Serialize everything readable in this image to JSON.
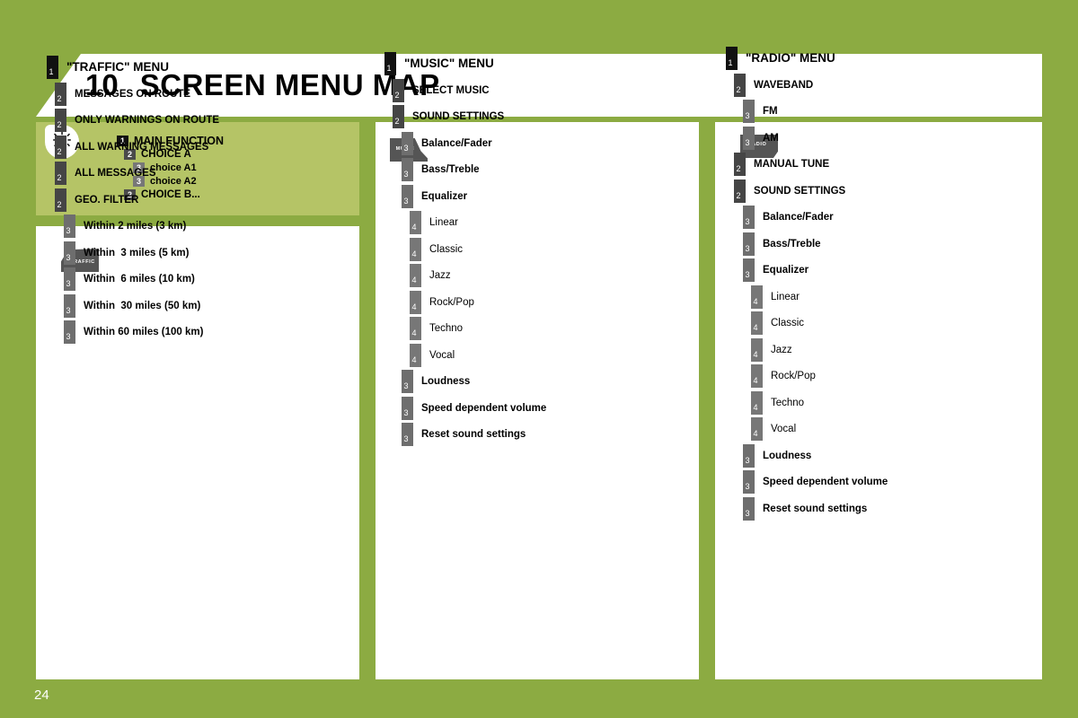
{
  "page": {
    "background_color": "#8cab42",
    "page_number": "24"
  },
  "header": {
    "chapter_number": "10",
    "title": "SCREEN MENU MAP"
  },
  "legend": {
    "icon_name": "info-bulb-icon",
    "box_color": "#b5c466",
    "items": [
      {
        "level": 1,
        "label": "MAIN FUNCTION",
        "badge": "1",
        "badge_color": "#111111"
      },
      {
        "level": 2,
        "label": "CHOICE A",
        "badge": "2",
        "badge_color": "#4a4a4a"
      },
      {
        "level": 3,
        "label": "choice A1",
        "badge": "3",
        "badge_color": "#777777"
      },
      {
        "level": 3,
        "label": "choice A2",
        "badge": "3",
        "badge_color": "#777777"
      },
      {
        "level": 2,
        "label": "CHOICE B...",
        "badge": "2",
        "badge_color": "#4a4a4a"
      }
    ]
  },
  "columns": [
    {
      "id": "traffic",
      "icon_label": "TRAFFIC",
      "icon_name": "traffic-button-icon",
      "items": [
        {
          "level": 1,
          "badge": "1",
          "label": "\"TRAFFIC\" MENU"
        },
        {
          "level": 2,
          "badge": "2",
          "label": "MESSAGES ON ROUTE"
        },
        {
          "level": 2,
          "badge": "2",
          "label": "ONLY WARNINGS ON ROUTE"
        },
        {
          "level": 2,
          "badge": "2",
          "label": "ALL WARNING MESSAGES"
        },
        {
          "level": 2,
          "badge": "2",
          "label": "ALL MESSAGES"
        },
        {
          "level": 2,
          "badge": "2",
          "label": "GEO. FILTER"
        },
        {
          "level": 3,
          "badge": "3",
          "label": "Within 2 miles (3 km)"
        },
        {
          "level": 3,
          "badge": "3",
          "label": "Within  3 miles (5 km)"
        },
        {
          "level": 3,
          "badge": "3",
          "label": "Within  6 miles (10 km)"
        },
        {
          "level": 3,
          "badge": "3",
          "label": "Within  30 miles (50 km)"
        },
        {
          "level": 3,
          "badge": "3",
          "label": "Within 60 miles (100 km)"
        }
      ]
    },
    {
      "id": "music",
      "icon_label": "MUSIC",
      "icon_name": "music-button-icon",
      "items": [
        {
          "level": 1,
          "badge": "1",
          "label": "\"MUSIC\" MENU"
        },
        {
          "level": 2,
          "badge": "2",
          "label": "SELECT MUSIC"
        },
        {
          "level": 2,
          "badge": "2",
          "label": "SOUND SETTINGS"
        },
        {
          "level": 3,
          "badge": "3",
          "label": "Balance/Fader"
        },
        {
          "level": 3,
          "badge": "3",
          "label": "Bass/Treble"
        },
        {
          "level": 3,
          "badge": "3",
          "label": "Equalizer"
        },
        {
          "level": 4,
          "badge": "4",
          "label": "Linear"
        },
        {
          "level": 4,
          "badge": "4",
          "label": "Classic"
        },
        {
          "level": 4,
          "badge": "4",
          "label": "Jazz"
        },
        {
          "level": 4,
          "badge": "4",
          "label": "Rock/Pop"
        },
        {
          "level": 4,
          "badge": "4",
          "label": "Techno"
        },
        {
          "level": 4,
          "badge": "4",
          "label": "Vocal"
        },
        {
          "level": 3,
          "badge": "3",
          "label": "Loudness"
        },
        {
          "level": 3,
          "badge": "3",
          "label": "Speed dependent volume"
        },
        {
          "level": 3,
          "badge": "3",
          "label": "Reset sound settings"
        }
      ]
    },
    {
      "id": "radio",
      "icon_label": "RADIO",
      "icon_name": "radio-button-icon",
      "items": [
        {
          "level": 1,
          "badge": "1",
          "label": "\"RADIO\" MENU"
        },
        {
          "level": 2,
          "badge": "2",
          "label": "WAVEBAND"
        },
        {
          "level": 3,
          "badge": "3",
          "label": "FM"
        },
        {
          "level": 3,
          "badge": "3",
          "label": "AM"
        },
        {
          "level": 2,
          "badge": "2",
          "label": "MANUAL TUNE"
        },
        {
          "level": 2,
          "badge": "2",
          "label": "SOUND SETTINGS"
        },
        {
          "level": 3,
          "badge": "3",
          "label": "Balance/Fader"
        },
        {
          "level": 3,
          "badge": "3",
          "label": "Bass/Treble"
        },
        {
          "level": 3,
          "badge": "3",
          "label": "Equalizer"
        },
        {
          "level": 4,
          "badge": "4",
          "label": "Linear"
        },
        {
          "level": 4,
          "badge": "4",
          "label": "Classic"
        },
        {
          "level": 4,
          "badge": "4",
          "label": "Jazz"
        },
        {
          "level": 4,
          "badge": "4",
          "label": "Rock/Pop"
        },
        {
          "level": 4,
          "badge": "4",
          "label": "Techno"
        },
        {
          "level": 4,
          "badge": "4",
          "label": "Vocal"
        },
        {
          "level": 3,
          "badge": "3",
          "label": "Loudness"
        },
        {
          "level": 3,
          "badge": "3",
          "label": "Speed dependent volume"
        },
        {
          "level": 3,
          "badge": "3",
          "label": "Reset sound settings"
        }
      ]
    }
  ]
}
